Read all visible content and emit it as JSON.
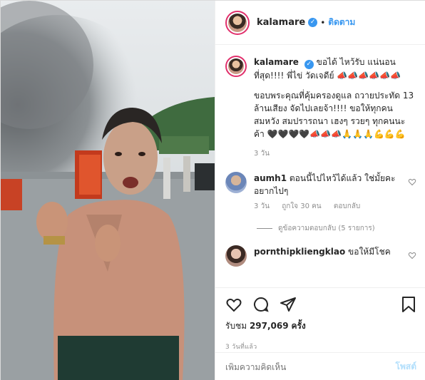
{
  "post": {
    "username": "kalamare",
    "follow_label": "ติดตาม",
    "dot": "•"
  },
  "caption": {
    "username": "kalamare",
    "text_line1": "ขอได้ ไหว้รับ แน่นอนที่สุด!!!! พี่ไข่ วัดเจดีย์ 📣📣📣📣📣📣",
    "text_line2": "ขอบพระคุณที่คุ้มครองดูแล ถวายประทัด 13 ล้านเสียง จัดไปเลยจ้า!!!! ขอให้ทุกคนสมหวัง สมปรารถนา เฮงๆ รวยๆ ทุกคนนะค้า 🖤🖤🖤🖤📣📣📣🙏🙏🙏💪💪💪",
    "time": "3 วัน"
  },
  "comments": [
    {
      "username": "aumh1",
      "text": "ตอนนี้ไปไหว้ได้แล้ว ใช่มั้ยคะ อยากไปๆ",
      "time": "3 วัน",
      "likes": "ถูกใจ 30 คน",
      "reply": "ตอบกลับ",
      "view_replies": "ดูข้อความตอบกลับ (5 รายการ)"
    },
    {
      "username": "pornthipkliengklao",
      "text": "ขอให้มีโชค"
    }
  ],
  "actions": {
    "views_label": "รับชม",
    "views_count": "297,069",
    "views_unit": "ครั้ง",
    "timestamp": "3 วันที่แล้ว"
  },
  "add_comment": {
    "placeholder": "เพิ่มความคิดเห็น",
    "post_label": "โพสต์"
  },
  "icons": [
    "heart-icon",
    "comment-icon",
    "share-icon",
    "bookmark-icon",
    "verified-icon"
  ],
  "colors": {
    "link": "#3897f0",
    "muted": "#8e8e8e",
    "post_disabled": "#b2dffc"
  }
}
